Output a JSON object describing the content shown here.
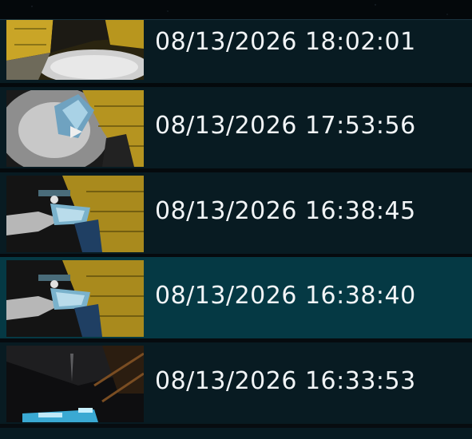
{
  "screenshots": [
    {
      "timestamp": "08/13/2026 18:02:01",
      "thumb": "yellow-room-floor"
    },
    {
      "timestamp": "08/13/2026 17:53:56",
      "thumb": "ice-block-hand"
    },
    {
      "timestamp": "08/13/2026 16:38:45",
      "thumb": "ice-rifle-yellow-wall"
    },
    {
      "timestamp": "08/13/2026 16:38:40",
      "thumb": "ice-rifle-yellow-wall"
    },
    {
      "timestamp": "08/13/2026 16:33:53",
      "thumb": "dark-ceiling-corridor"
    }
  ],
  "selected_index": 3,
  "colors": {
    "row_bg": "#081b22",
    "row_selected_bg": "#053944",
    "text": "#f2f5f7"
  }
}
